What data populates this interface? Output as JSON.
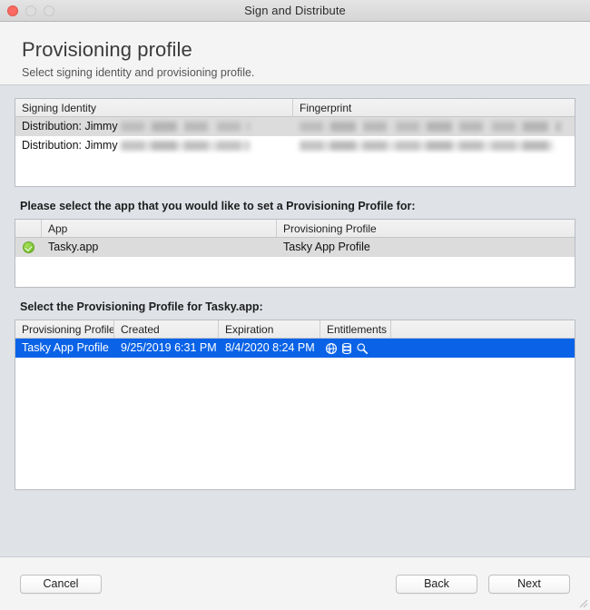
{
  "window": {
    "title": "Sign and Distribute",
    "traffic_lights": [
      "close-button",
      "minimize-button",
      "zoom-button"
    ]
  },
  "header": {
    "title": "Provisioning profile",
    "subtitle": "Select signing identity and provisioning profile."
  },
  "identity_table": {
    "columns": [
      "Signing Identity",
      "Fingerprint"
    ],
    "rows": [
      {
        "signing_identity": "Distribution: Jimmy",
        "identity_redacted": true,
        "fingerprint": "",
        "fingerprint_redacted": true,
        "selected": true
      },
      {
        "signing_identity": "Distribution: Jimmy",
        "identity_redacted": true,
        "fingerprint": "",
        "fingerprint_redacted": true,
        "selected": false
      }
    ]
  },
  "app_section": {
    "label": "Please select the app that you would like to set a Provisioning Profile for:",
    "columns": [
      "",
      "App",
      "Provisioning Profile"
    ],
    "rows": [
      {
        "status_icon": "green-check-icon",
        "app": "Tasky.app",
        "provisioning_profile": "Tasky App Profile",
        "selected": true
      }
    ]
  },
  "profile_section": {
    "label": "Select the Provisioning Profile for Tasky.app:",
    "columns": [
      "Provisioning Profile",
      "Created",
      "Expiration",
      "Entitlements",
      ""
    ],
    "rows": [
      {
        "provisioning_profile": "Tasky App Profile",
        "created": "9/25/2019 6:31 PM",
        "expiration": "8/4/2020 8:24 PM",
        "entitlements": [
          "globe-icon",
          "database-icon",
          "magnifier-icon"
        ],
        "selected": true
      }
    ]
  },
  "footer": {
    "cancel_label": "Cancel",
    "back_label": "Back",
    "next_label": "Next"
  },
  "colors": {
    "selection_blue": "#0a63e7",
    "row_alt_gray": "#dcdcdc",
    "window_background": "#dfe3e8",
    "panel_background": "#f4f4f4",
    "check_green": "#7ec634",
    "close_red": "#fb6a61"
  }
}
